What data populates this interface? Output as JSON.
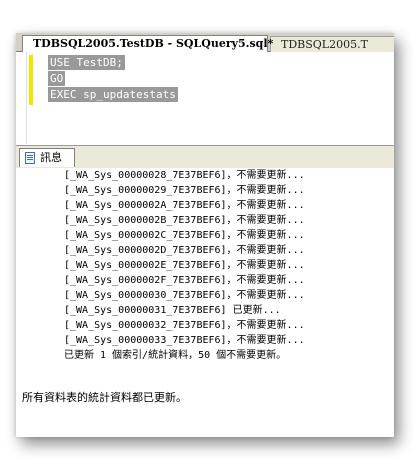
{
  "tabs": [
    {
      "label": "TDBSQL2005.TestDB - SQLQuery5.sql*",
      "active": true
    },
    {
      "label": "TDBSQL2005.T",
      "active": false
    }
  ],
  "editor": {
    "lines": [
      "USE TestDB;",
      "GO",
      "EXEC sp_updatestats"
    ],
    "selection_color": "#999999",
    "change_bar_color": "#f2e600"
  },
  "results": {
    "tab_label": "訊息",
    "tab_icon": "message-icon",
    "lines": [
      "[_WA_Sys_00000028_7E37BEF6]，不需要更新...",
      "[_WA_Sys_00000029_7E37BEF6]，不需要更新...",
      "[_WA_Sys_0000002A_7E37BEF6]，不需要更新...",
      "[_WA_Sys_0000002B_7E37BEF6]，不需要更新...",
      "[_WA_Sys_0000002C_7E37BEF6]，不需要更新...",
      "[_WA_Sys_0000002D_7E37BEF6]，不需要更新...",
      "[_WA_Sys_0000002E_7E37BEF6]，不需要更新...",
      "[_WA_Sys_0000002F_7E37BEF6]，不需要更新...",
      "[_WA_Sys_00000030_7E37BEF6]，不需要更新...",
      "[_WA_Sys_00000031_7E37BEF6] 已更新...",
      "[_WA_Sys_00000032_7E37BEF6]，不需要更新...",
      "[_WA_Sys_00000033_7E37BEF6]，不需要更新..."
    ],
    "summary": "已更新 1 個索引/統計資料，50 個不需要更新。",
    "final": "所有資料表的統計資料都已更新。"
  }
}
